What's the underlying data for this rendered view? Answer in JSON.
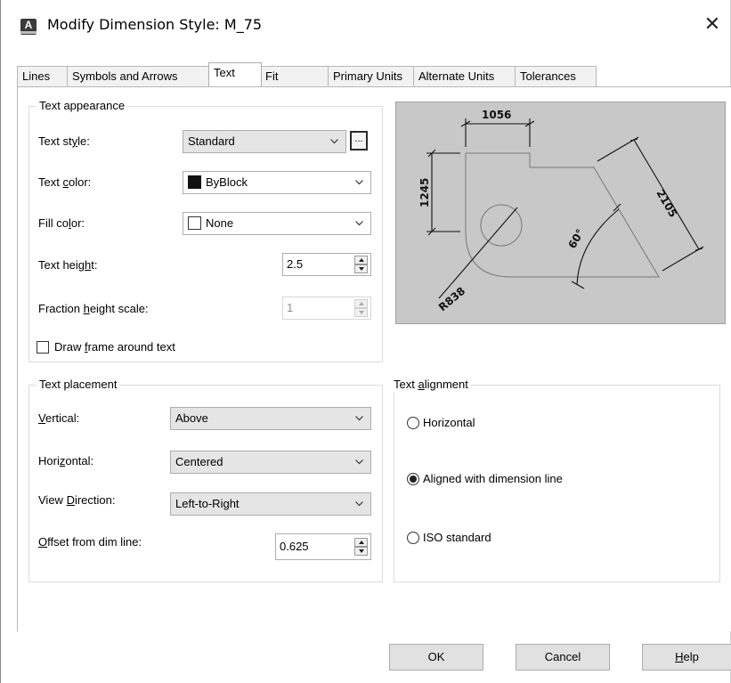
{
  "window": {
    "title": "Modify Dimension Style: M_75",
    "app_icon_letter": "A",
    "close_glyph": "✕"
  },
  "tabs": [
    {
      "label": "Lines"
    },
    {
      "label": "Symbols and Arrows"
    },
    {
      "label": "Text"
    },
    {
      "label": "Fit"
    },
    {
      "label": "Primary Units"
    },
    {
      "label": "Alternate Units"
    },
    {
      "label": "Tolerances"
    }
  ],
  "active_tab": "Text",
  "text_appearance": {
    "title": "Text appearance",
    "text_style": {
      "label_pre": "Text st",
      "label_ul": "y",
      "label_post": "le:",
      "value": "Standard",
      "browse": "..."
    },
    "text_color": {
      "label_pre": "Text ",
      "label_ul": "c",
      "label_post": "olor:",
      "value": "ByBlock",
      "swatch": "#111111"
    },
    "fill_color": {
      "label_pre": "Fill co",
      "label_ul": "l",
      "label_post": "or:",
      "value": "None",
      "swatch": "#ffffff"
    },
    "text_height": {
      "label_pre": "Text heig",
      "label_ul": "h",
      "label_post": "t:",
      "value": "2.5"
    },
    "fraction_height": {
      "label_pre": "Fraction ",
      "label_ul": "h",
      "label_post": "eight scale:",
      "value": "1",
      "enabled": false
    },
    "draw_frame": {
      "label_pre": "Draw ",
      "label_ul": "f",
      "label_post": "rame around text",
      "checked": false
    }
  },
  "text_placement": {
    "title": "Text placement",
    "vertical": {
      "label_pre": "",
      "label_ul": "V",
      "label_post": "ertical:",
      "value": "Above"
    },
    "horizontal": {
      "label_pre": "Hori",
      "label_ul": "z",
      "label_post": "ontal:",
      "value": "Centered"
    },
    "view_direction": {
      "label_pre": "View ",
      "label_ul": "D",
      "label_post": "irection:",
      "value": "Left-to-Right"
    },
    "offset": {
      "label_pre": "",
      "label_ul": "O",
      "label_post": "ffset from dim line:",
      "value": "0.625"
    }
  },
  "text_alignment": {
    "title_pre": "Text ",
    "title_ul": "a",
    "title_post": "lignment",
    "options": [
      {
        "label": "Horizontal",
        "checked": false
      },
      {
        "label": "Aligned with dimension line",
        "checked": true
      },
      {
        "label": "ISO standard",
        "checked": false
      }
    ]
  },
  "preview": {
    "dim_top": "1056",
    "dim_left": "1245",
    "dim_right": "2105",
    "dim_angle": "60°",
    "dim_radius": "R838"
  },
  "buttons": {
    "ok": "OK",
    "cancel": "Cancel",
    "help_ul": "H",
    "help_post": "elp"
  }
}
